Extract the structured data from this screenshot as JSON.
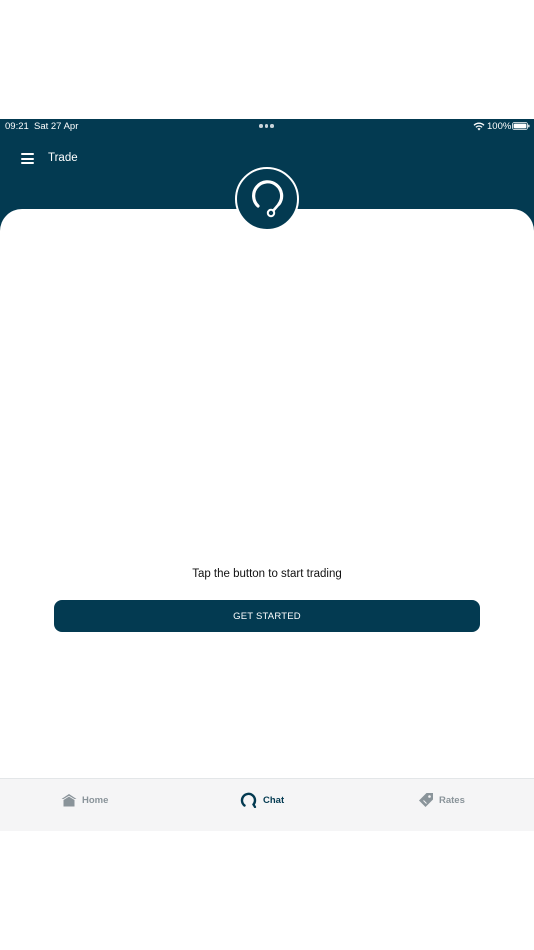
{
  "status_bar": {
    "time": "09:21",
    "date": "Sat 27 Apr",
    "battery": "100%"
  },
  "header": {
    "title": "Trade"
  },
  "main": {
    "prompt": "Tap the button to start trading",
    "button_label": "GET STARTED"
  },
  "tabs": [
    {
      "label": "Home",
      "icon": "home-icon",
      "active": false
    },
    {
      "label": "Chat",
      "icon": "chat-icon",
      "active": true
    },
    {
      "label": "Rates",
      "icon": "tag-icon",
      "active": false
    }
  ],
  "colors": {
    "brand": "#033a51",
    "inactive_tab": "#8a949a",
    "tab_bar_bg": "#f5f5f6"
  }
}
